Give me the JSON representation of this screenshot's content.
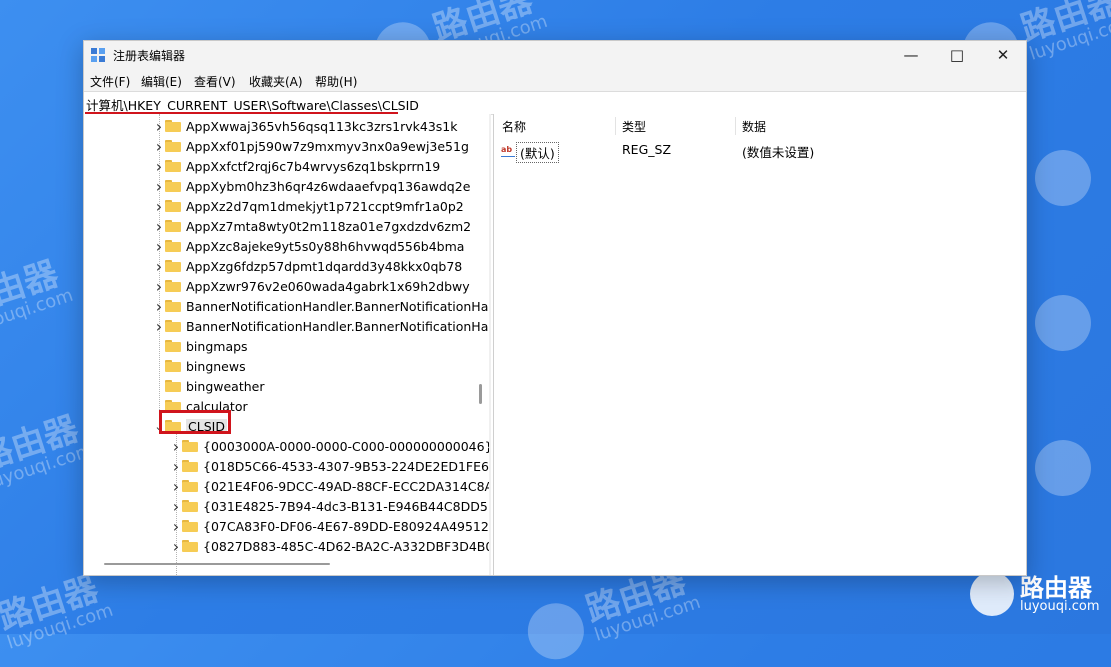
{
  "window": {
    "title": "注册表编辑器"
  },
  "menu": [
    "文件(F)",
    "编辑(E)",
    "查看(V)",
    "收藏夹(A)",
    "帮助(H)"
  ],
  "address": "计算机\\HKEY_CURRENT_USER\\Software\\Classes\\CLSID",
  "tree": {
    "items": [
      {
        "label": "AppXwwaj365vh56qsq113kc3zrs1rvk43s1k",
        "expandable": true,
        "level": 1
      },
      {
        "label": "AppXxf01pj590w7z9mxmyv3nx0a9ewj3e51g",
        "expandable": true,
        "level": 1
      },
      {
        "label": "AppXxfctf2rqj6c7b4wrvys6zq1bskprrn19",
        "expandable": true,
        "level": 1
      },
      {
        "label": "AppXybm0hz3h6qr4z6wdaaefvpq136awdq2e",
        "expandable": true,
        "level": 1
      },
      {
        "label": "AppXz2d7qm1dmekjyt1p721ccpt9mfr1a0p2",
        "expandable": true,
        "level": 1
      },
      {
        "label": "AppXz7mta8wty0t2m118za01e7gxdzdv6zm2",
        "expandable": true,
        "level": 1
      },
      {
        "label": "AppXzc8ajeke9yt5s0y88h6hvwqd556b4bma",
        "expandable": true,
        "level": 1
      },
      {
        "label": "AppXzg6fdzp57dpmt1dqardd3y48kkx0qb78",
        "expandable": true,
        "level": 1
      },
      {
        "label": "AppXzwr976v2e060wada4gabrk1x69h2dbwy",
        "expandable": true,
        "level": 1
      },
      {
        "label": "BannerNotificationHandler.BannerNotificationHa",
        "expandable": true,
        "level": 1
      },
      {
        "label": "BannerNotificationHandler.BannerNotificationHa",
        "expandable": true,
        "level": 1
      },
      {
        "label": "bingmaps",
        "expandable": false,
        "level": 1
      },
      {
        "label": "bingnews",
        "expandable": false,
        "level": 1
      },
      {
        "label": "bingweather",
        "expandable": false,
        "level": 1
      },
      {
        "label": "calculator",
        "expandable": false,
        "level": 1
      },
      {
        "label": "CLSID",
        "expandable": true,
        "expanded": true,
        "selected": true,
        "level": 1
      },
      {
        "label": "{0003000A-0000-0000-C000-000000000046}",
        "expandable": true,
        "level": 2
      },
      {
        "label": "{018D5C66-4533-4307-9B53-224DE2ED1FE6}",
        "expandable": true,
        "level": 2
      },
      {
        "label": "{021E4F06-9DCC-49AD-88CF-ECC2DA314C8A}",
        "expandable": true,
        "level": 2
      },
      {
        "label": "{031E4825-7B94-4dc3-B131-E946B44C8DD5}",
        "expandable": true,
        "level": 2
      },
      {
        "label": "{07CA83F0-DF06-4E67-89DD-E80924A49512}",
        "expandable": true,
        "level": 2
      },
      {
        "label": "{0827D883-485C-4D62-BA2C-A332DBF3D4B0}",
        "expandable": true,
        "level": 2
      }
    ]
  },
  "list": {
    "headers": {
      "name": "名称",
      "type": "类型",
      "data": "数据"
    },
    "rows": [
      {
        "icon": "string-value-icon",
        "icon_text": "ab",
        "name": "(默认)",
        "type": "REG_SZ",
        "data": "(数值未设置)"
      }
    ]
  },
  "watermark": {
    "cn": "路由器",
    "en": "luyouqi.com"
  },
  "colors": {
    "highlight": "#d0141c",
    "folder": "#f6cc55",
    "background": "#2d7de6"
  }
}
